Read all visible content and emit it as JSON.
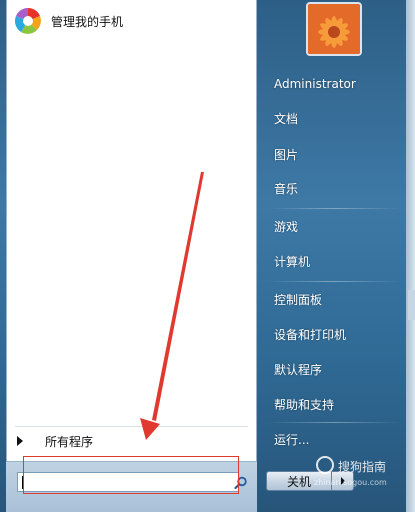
{
  "pinned": {
    "app_label": "管理我的手机"
  },
  "left": {
    "all_programs": "所有程序"
  },
  "search": {
    "value": ""
  },
  "right_menu": {
    "items": [
      "Administrator",
      "文档",
      "图片",
      "音乐",
      "游戏",
      "计算机",
      "控制面板",
      "设备和打印机",
      "默认程序",
      "帮助和支持",
      "运行..."
    ]
  },
  "shutdown": {
    "label": "关机"
  },
  "watermark": {
    "main": "搜狗指南",
    "sub": "zhinan.sogou.com"
  },
  "colors": {
    "annotation_red": "#e0392f",
    "panel_white": "#ffffff",
    "menu_blue": "#3e79a6"
  },
  "icons": [
    "app-icon",
    "triangle-right-icon",
    "search-icon",
    "user-picture",
    "chevron-right-icon",
    "annotation-arrow"
  ]
}
